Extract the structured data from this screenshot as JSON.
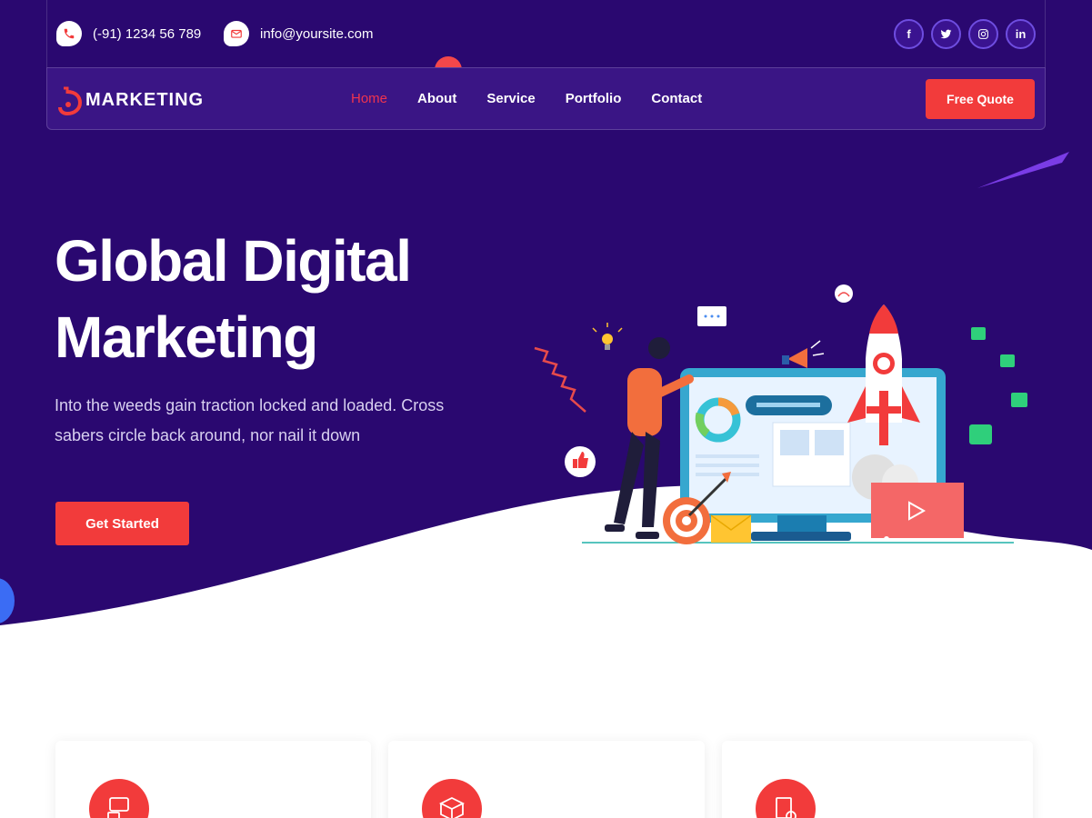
{
  "topbar": {
    "phone": "(-91) 1234 56 789",
    "email": "info@yoursite.com",
    "phone_icon": "phone-icon",
    "email_icon": "envelope-icon",
    "socials": [
      {
        "icon": "facebook-icon",
        "glyph": "f"
      },
      {
        "icon": "twitter-icon",
        "glyph": "t"
      },
      {
        "icon": "instagram-icon",
        "glyph": "◎"
      },
      {
        "icon": "linkedin-icon",
        "glyph": "in"
      }
    ]
  },
  "nav": {
    "logo": "MARKETING",
    "items": [
      {
        "label": "Home",
        "active": true
      },
      {
        "label": "About",
        "active": false
      },
      {
        "label": "Service",
        "active": false
      },
      {
        "label": "Portfolio",
        "active": false
      },
      {
        "label": "Contact",
        "active": false
      }
    ],
    "cta": "Free Quote"
  },
  "hero": {
    "title_line1": "Global Digital",
    "title_line2": "Marketing",
    "description": "Into the weeds gain traction locked and loaded. Cross sabers circle back around, nor nail it down",
    "button": "Get Started"
  },
  "services": {
    "cards": [
      {
        "icon": "chat-devices-icon"
      },
      {
        "icon": "boxes-icon"
      },
      {
        "icon": "document-gear-icon"
      }
    ]
  },
  "colors": {
    "hero_bg": "#2a0870",
    "accent": "#f23b3b",
    "nav_active": "#f0344e"
  }
}
